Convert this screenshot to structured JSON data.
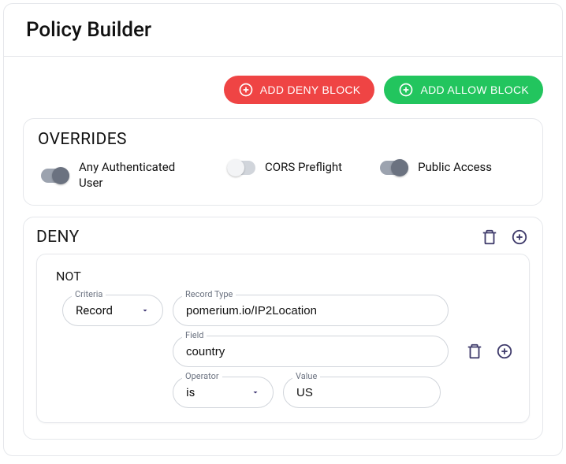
{
  "header": {
    "title": "Policy Builder"
  },
  "actions": {
    "add_deny": "ADD DENY BLOCK",
    "add_allow": "ADD ALLOW BLOCK"
  },
  "overrides": {
    "title": "OVERRIDES",
    "items": [
      {
        "label": "Any Authenticated User",
        "on": false
      },
      {
        "label": "CORS Preflight",
        "on": false
      },
      {
        "label": "Public Access",
        "on": false
      }
    ]
  },
  "deny": {
    "title": "DENY",
    "group": {
      "logic": "NOT",
      "criteria": {
        "label": "Criteria",
        "value": "Record"
      },
      "record_type": {
        "label": "Record Type",
        "value": "pomerium.io/IP2Location"
      },
      "field": {
        "label": "Field",
        "value": "country"
      },
      "operator": {
        "label": "Operator",
        "value": "is"
      },
      "value": {
        "label": "Value",
        "value": "US"
      }
    }
  }
}
